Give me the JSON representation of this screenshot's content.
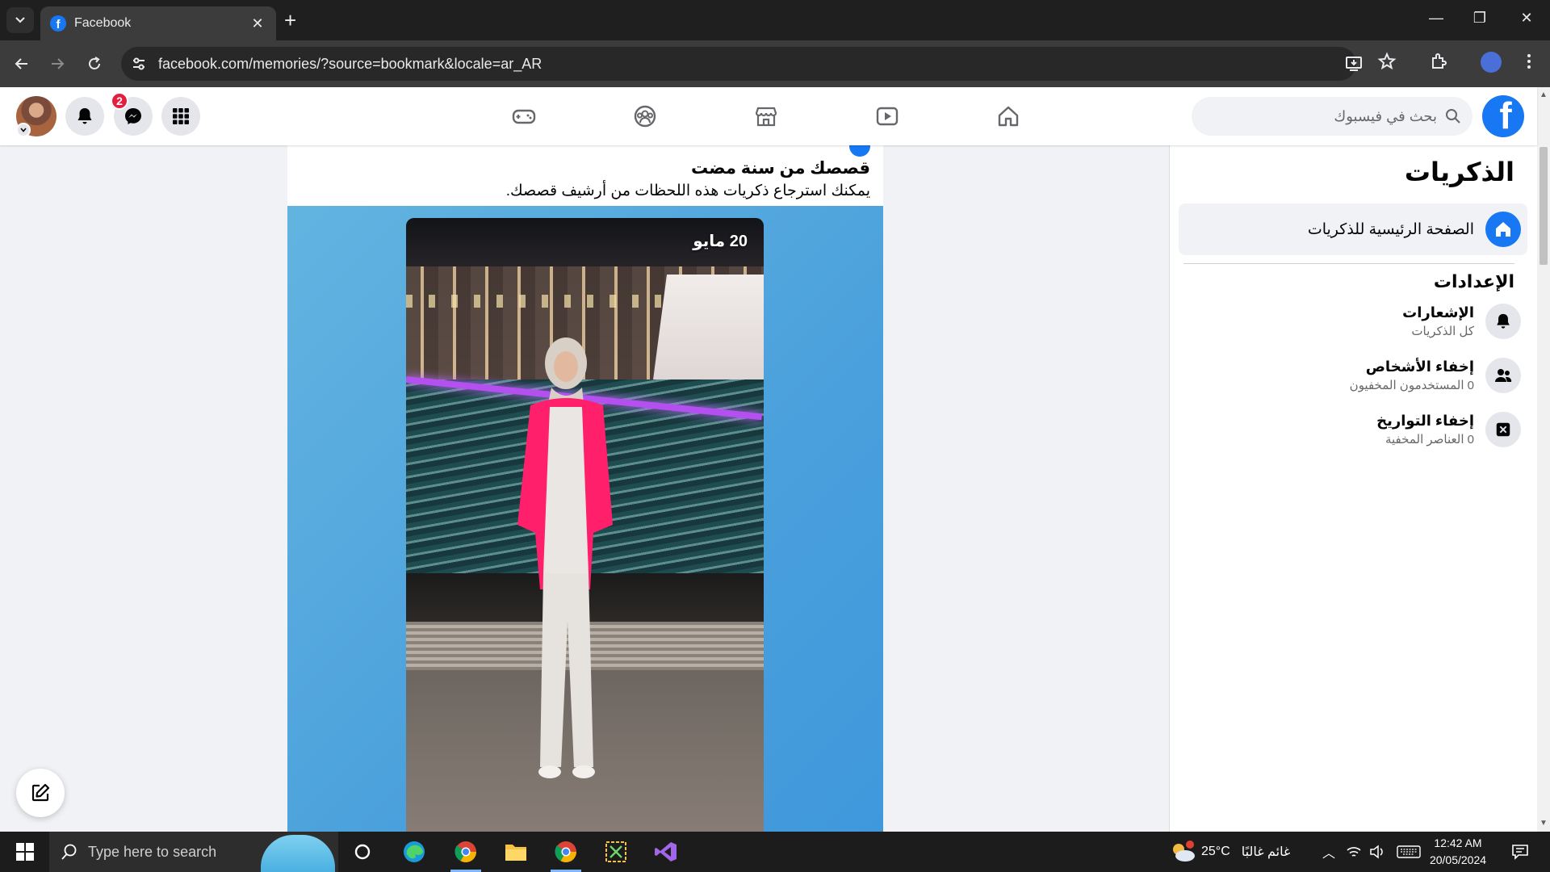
{
  "browser": {
    "tab_title": "Facebook",
    "url": "facebook.com/memories/?source=bookmark&locale=ar_AR"
  },
  "header": {
    "search_placeholder": "بحث في فيسبوك",
    "notification_badge": "2"
  },
  "memory_card": {
    "title": "قصصك من سنة مضت",
    "subtitle": "يمكنك استرجاع ذكريات هذه اللحظات من أرشيف قصصك.",
    "story_date": "20 مايو"
  },
  "sidebar": {
    "title": "الذكريات",
    "home_label": "الصفحة الرئيسية للذكريات",
    "settings_title": "الإعدادات",
    "items": [
      {
        "label": "الإشعارات",
        "sub": "كل الذكريات",
        "icon": "bell-icon"
      },
      {
        "label": "إخفاء الأشخاص",
        "sub": "0 المستخدمون المخفيون",
        "icon": "people-icon"
      },
      {
        "label": "إخفاء التواريخ",
        "sub": "0 العناصر المخفية",
        "icon": "calendar-x-icon"
      }
    ]
  },
  "taskbar": {
    "search_placeholder": "Type here to search",
    "weather_temp": "25°C",
    "weather_text": "غائم غالبًا",
    "time": "12:42 AM",
    "date": "20/05/2024"
  },
  "colors": {
    "facebook_blue": "#1877f2",
    "badge_red": "#e41e3f",
    "story_background": "#4aa0dc"
  }
}
